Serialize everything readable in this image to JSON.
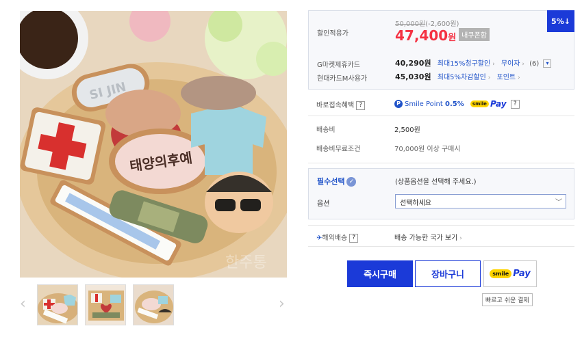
{
  "gallery": {
    "main_image_alt": "",
    "prev_arrow": "‹",
    "next_arrow": "›",
    "watermark": "한주통"
  },
  "price": {
    "discount_badge": "5%↓",
    "sale_label": "할인적용가",
    "original_price": "50,000원",
    "discount_amount": "(-2,600원)",
    "sale_price": "47,400",
    "sale_unit": "원",
    "coupon_tag": "내쿠폰함",
    "card1_label": "G마켓제휴카드",
    "card1_price": "40,290원",
    "card1_benefit": "최대15%청구할인",
    "card1_interest": "무이자",
    "card1_count": "(6)",
    "card2_label": "현대카드M사용가",
    "card2_price": "45,030원",
    "card2_benefit": "최대5%차감할인",
    "card2_point": "포인트"
  },
  "benefit": {
    "label": "바로접속혜택",
    "smile_point_text": "Smile Point",
    "smile_point_rate": "0.5%",
    "smile_badge": "smile",
    "pay_text": "Pay"
  },
  "shipping": {
    "fee_label": "배송비",
    "fee_value": "2,500원",
    "free_label": "배송비무료조건",
    "free_value": "70,000원 이상 구매시"
  },
  "options": {
    "required_label": "필수선택",
    "hint": "(상품옵션을 선택해 주세요.)",
    "option_label": "옵션",
    "select_value": "선택하세요"
  },
  "overseas": {
    "label": "해외배송",
    "link": "배송 가능한 국가 보기"
  },
  "actions": {
    "buy_now": "즉시구매",
    "cart": "장바구니",
    "smilepay_badge": "smile",
    "smilepay_pay": "Pay",
    "smilepay_tooltip": "빠르고 쉬운 결제"
  },
  "colors": {
    "accent_blue": "#1b3ad8",
    "price_red": "#f43142",
    "link_blue": "#2053c9"
  }
}
